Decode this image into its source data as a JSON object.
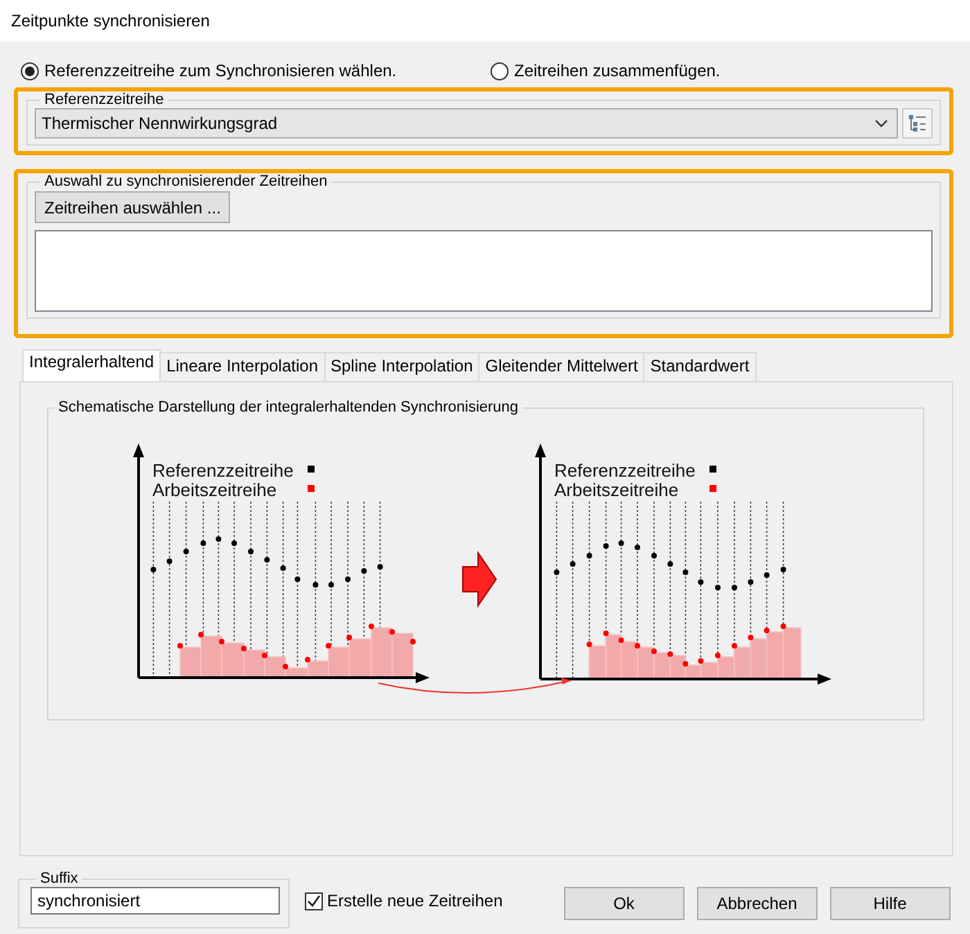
{
  "window": {
    "title": "Zeitpunkte synchronisieren"
  },
  "mode_options": [
    {
      "label": "Referenzzeitreihe zum Synchronisieren wählen.",
      "selected": true
    },
    {
      "label": "Zeitreihen zusammenfügen.",
      "selected": false
    }
  ],
  "reference_group": {
    "title": "Referenzzeitreihe",
    "value": "Thermischer Nennwirkungsgrad"
  },
  "selection_group": {
    "title": "Auswahl zu synchronisierender Zeitreihen",
    "button": "Zeitreihen auswählen ..."
  },
  "tabs": [
    {
      "label": "Integralerhaltend",
      "selected": true
    },
    {
      "label": "Lineare Interpolation",
      "selected": false
    },
    {
      "label": "Spline Interpolation",
      "selected": false
    },
    {
      "label": "Gleitender Mittelwert",
      "selected": false
    },
    {
      "label": "Standardwert",
      "selected": false
    }
  ],
  "schematic": {
    "title": "Schematische Darstellung der integralerhaltenden Synchronisierung",
    "panels": [
      {
        "legend": [
          {
            "label": "Referenzzeitreihe",
            "color": "#000000"
          },
          {
            "label": "Arbeitszeitreihe",
            "color": "#ff0000"
          }
        ]
      },
      {
        "legend": [
          {
            "label": "Referenzzeitreihe",
            "color": "#000000"
          },
          {
            "label": "Arbeitszeitreihe",
            "color": "#ff0000"
          }
        ]
      }
    ]
  },
  "suffix": {
    "label": "Suffix",
    "value": "synchronisiert"
  },
  "create_new": {
    "label": "Erstelle neue Zeitreihen",
    "checked": true
  },
  "buttons": [
    "Ok",
    "Abbrechen",
    "Hilfe"
  ]
}
